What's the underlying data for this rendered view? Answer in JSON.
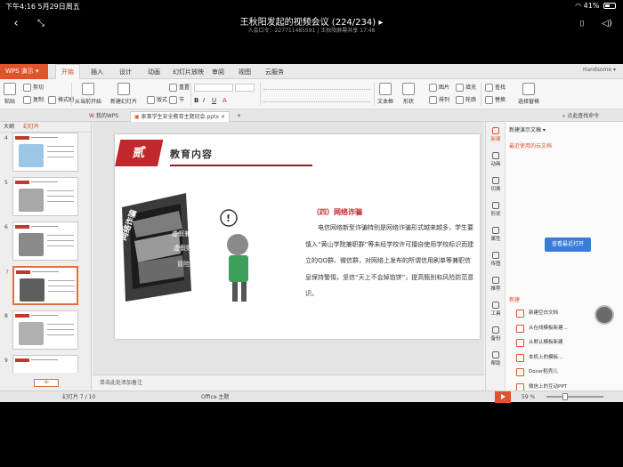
{
  "status_bar": {
    "time_date": "下午4:16   5月29日周五",
    "battery": "41%"
  },
  "meeting": {
    "title": "王秋阳发起的视频会议 (224/234) ▸",
    "subtitle": "入会口令：227711485591 | 王秋阳屏幕共享 17:48"
  },
  "app": {
    "wps_label": "WPS 演示 ▾",
    "menus": [
      "开始",
      "插入",
      "设计",
      "动画",
      "幻灯片放映",
      "审阅",
      "视图",
      "云服务"
    ],
    "active_menu": "开始",
    "user": "Handsome ▾",
    "ribbon": {
      "cut": "剪切",
      "paste": "粘贴",
      "copy": "复制",
      "format_painter": "格式刷",
      "from_current": "从当前开始",
      "new_slide": "新建幻灯片",
      "layout": "版式",
      "section": "节",
      "reset": "重置",
      "textbox": "文本框",
      "shape": "形状",
      "arrange": "排列",
      "picture": "图片",
      "fill": "填充",
      "outline": "轮廓",
      "find": "查找",
      "replace": "替换",
      "select_pane": "选择窗格"
    },
    "tabs": [
      "我的WPS",
      "家事学生安全教育主题班会.pptx"
    ],
    "tab_search": "点此查找命令"
  },
  "left_pane": {
    "outline_tab": "大纲",
    "slides_tab": "幻灯片",
    "slide_numbers": [
      "4",
      "5",
      "6",
      "7",
      "8",
      "9"
    ],
    "selected": "7",
    "add_label": "+"
  },
  "slide": {
    "badge": "贰",
    "section_title": "教育内容",
    "subheading": "（四）网络诈骗",
    "paragraph": "电信网络新型诈骗特别是网络诈骗形式越来越多，学生要慎入“黄山学院兼职群”等未经学校许可擅自使用学校标识而建立的QQ群、微信群，对网络上发布的所谓信用刷单等兼职信息保持警惕，坚信“天上不会掉馅饼”，提高甄别和风险防范意识。",
    "illus_labels": [
      "网络诈骗",
      "虚假兼职",
      "虚假购物",
      "冒险求助"
    ],
    "exclamation": "!"
  },
  "notes_placeholder": "单击此处添加备注",
  "vbar": [
    "新建",
    "动画",
    "切换",
    "形状",
    "属性",
    "传图",
    "推荐",
    "工具",
    "备份",
    "帮助"
  ],
  "right_panel": {
    "header": "新建演示文稿 ▾",
    "recent": "最近使用的云文档",
    "open_button": "查看最近打开",
    "new_label": "新建",
    "items": [
      "新建空白文档",
      "从在线模板新建...",
      "从默认模板新建",
      "本机上的模板...",
      "Docer稻壳儿",
      "微信上的互动PPT"
    ]
  },
  "status": {
    "slide_counter": "幻灯片 7 / 10",
    "theme": "Office 主题",
    "zoom": "59 %"
  }
}
